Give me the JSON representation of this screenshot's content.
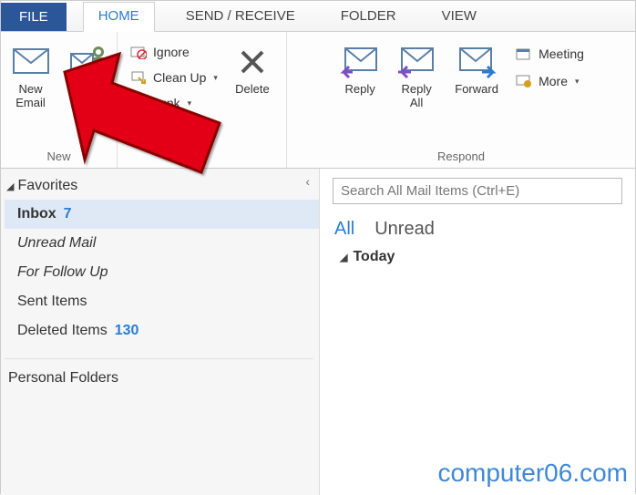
{
  "tabs": {
    "file": "FILE",
    "home": "HOME",
    "sendreceive": "SEND / RECEIVE",
    "folder": "FOLDER",
    "view": "VIEW"
  },
  "ribbon": {
    "new": {
      "group_label": "New",
      "new_email": "New\nEmail",
      "new_items": "New\nItems"
    },
    "delete": {
      "ignore": "Ignore",
      "cleanup": "Clean Up",
      "junk": "Junk",
      "delete": "Delete"
    },
    "respond": {
      "group_label": "Respond",
      "reply": "Reply",
      "reply_all": "Reply\nAll",
      "forward": "Forward",
      "meeting": "Meeting",
      "more": "More"
    }
  },
  "sidebar": {
    "favorites_label": "Favorites",
    "items": [
      {
        "label": "Inbox",
        "count": "7",
        "style": "bold selected"
      },
      {
        "label": "Unread Mail",
        "count": "",
        "style": "italic"
      },
      {
        "label": "For Follow Up",
        "count": "",
        "style": "italic"
      },
      {
        "label": "Sent Items",
        "count": "",
        "style": ""
      },
      {
        "label": "Deleted Items",
        "count": "130",
        "style": ""
      }
    ],
    "personal_label": "Personal Folders"
  },
  "content": {
    "search_placeholder": "Search All Mail Items (Ctrl+E)",
    "filter_all": "All",
    "filter_unread": "Unread",
    "group_today": "Today"
  },
  "watermark": "computer06.com"
}
